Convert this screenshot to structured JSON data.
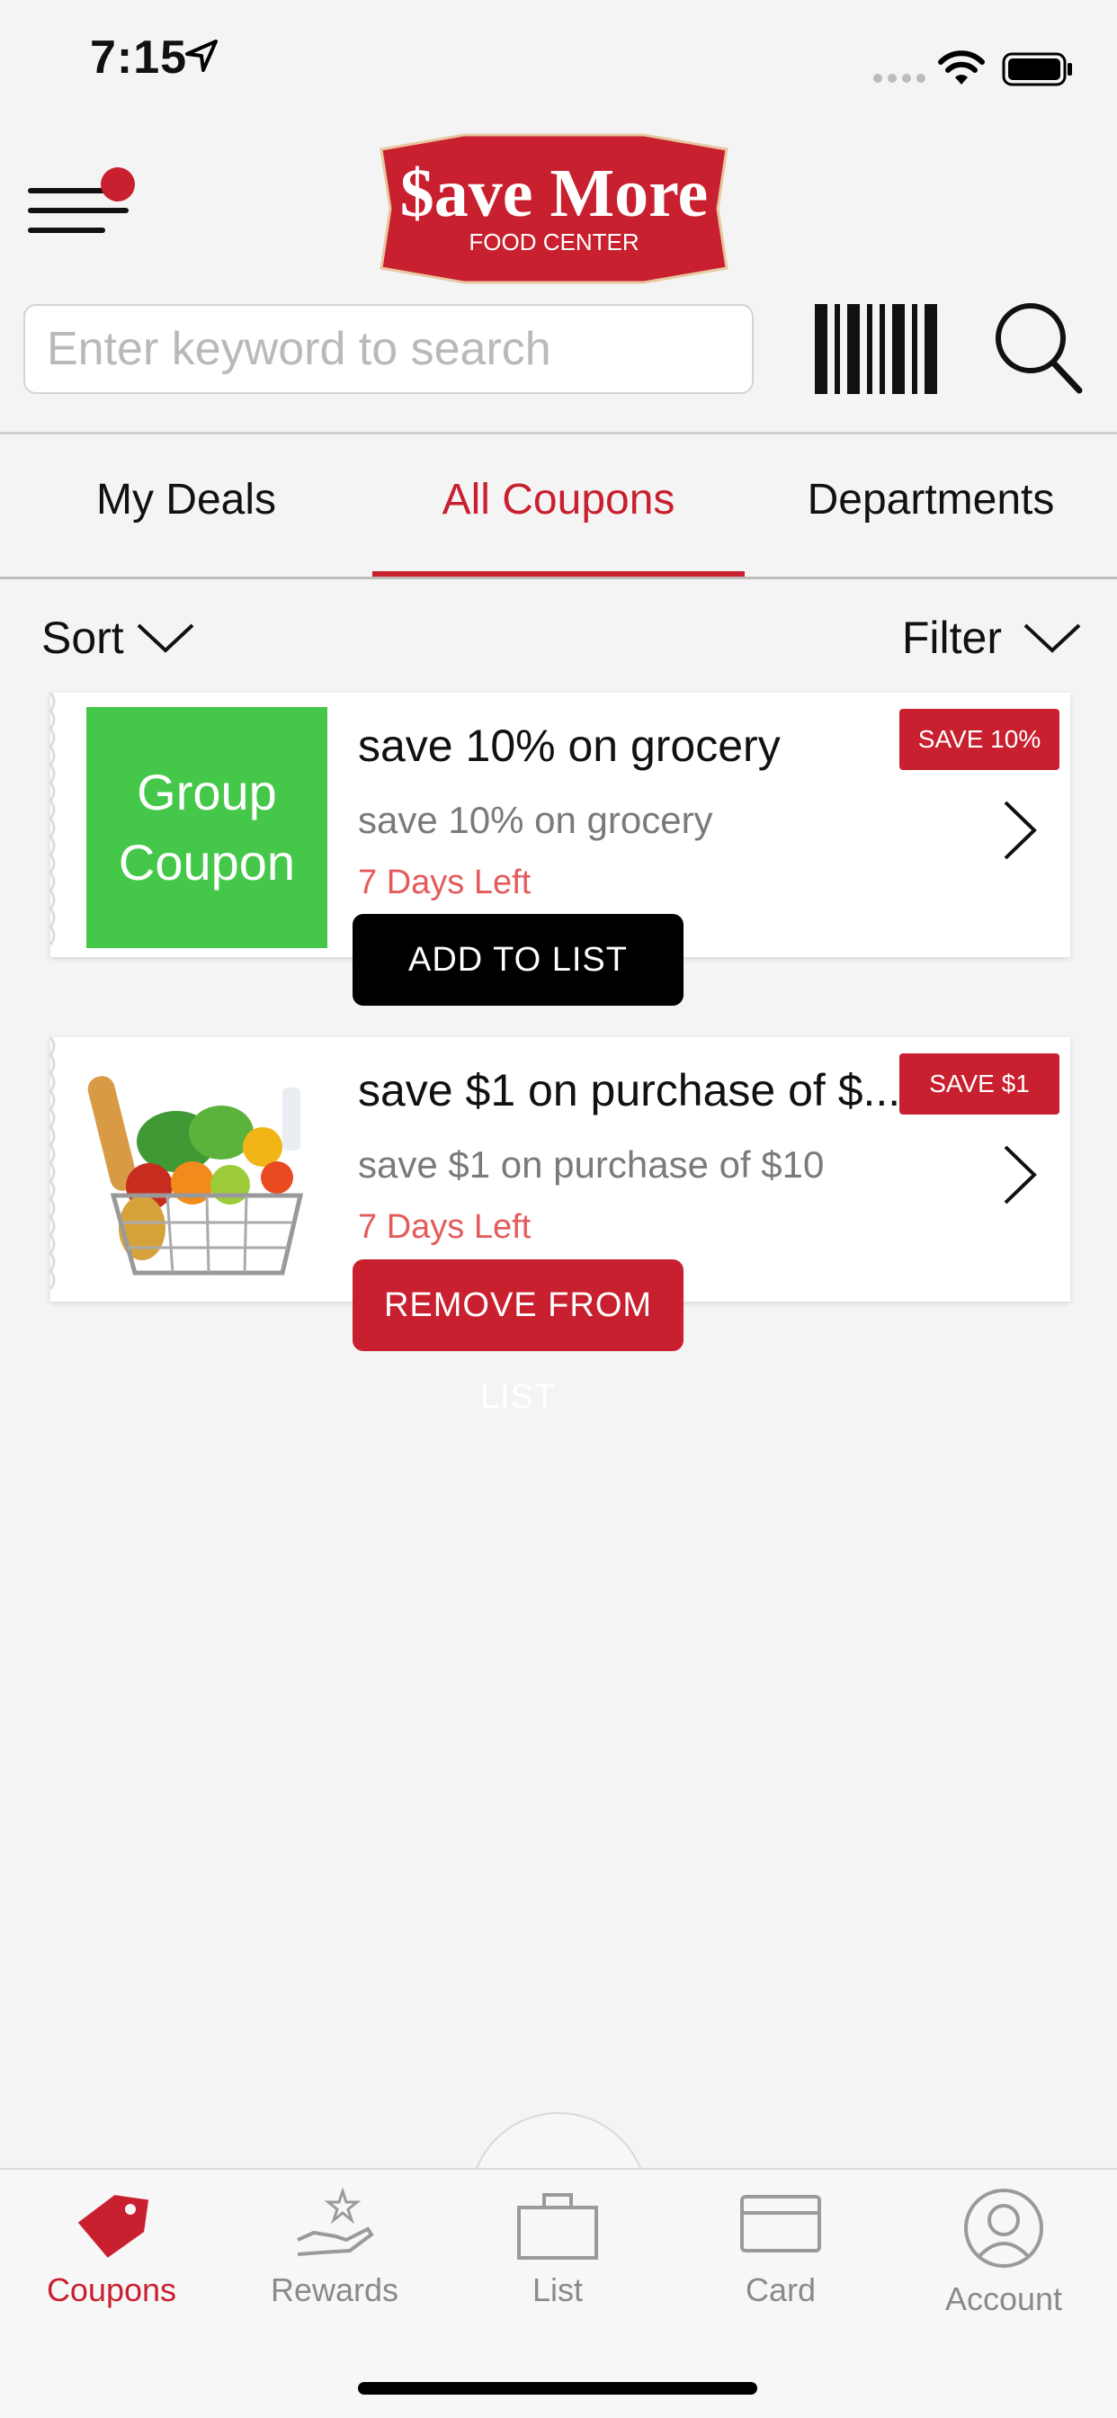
{
  "status_bar": {
    "time": "7:15"
  },
  "header": {
    "logo_line1": "$ave More",
    "logo_line2": "FOOD CENTER",
    "search_placeholder": "Enter keyword to search"
  },
  "tabs": [
    {
      "label": "My Deals",
      "active": false
    },
    {
      "label": "All Coupons",
      "active": true
    },
    {
      "label": "Departments",
      "active": false
    }
  ],
  "toolbar": {
    "sort_label": "Sort",
    "filter_label": "Filter"
  },
  "coupons": [
    {
      "image_text_line1": "Group",
      "image_text_line2": "Coupon",
      "title": "save 10% on grocery",
      "subtitle": "save 10% on grocery",
      "days_left": "7 Days Left",
      "badge": "SAVE 10%",
      "action": "ADD TO LIST"
    },
    {
      "title": "save $1 on purchase of $...",
      "subtitle": "save $1 on purchase of $10",
      "days_left": "7 Days Left",
      "badge": "SAVE $1",
      "action": "REMOVE FROM LIST"
    }
  ],
  "bottom_nav": [
    {
      "label": "Coupons",
      "active": true
    },
    {
      "label": "Rewards",
      "active": false
    },
    {
      "label": "List",
      "active": false
    },
    {
      "label": "Card",
      "active": false
    },
    {
      "label": "Account",
      "active": false
    }
  ],
  "colors": {
    "brand_red": "#c8202f",
    "group_green": "#45c84a",
    "days_left": "#e45b5b"
  }
}
